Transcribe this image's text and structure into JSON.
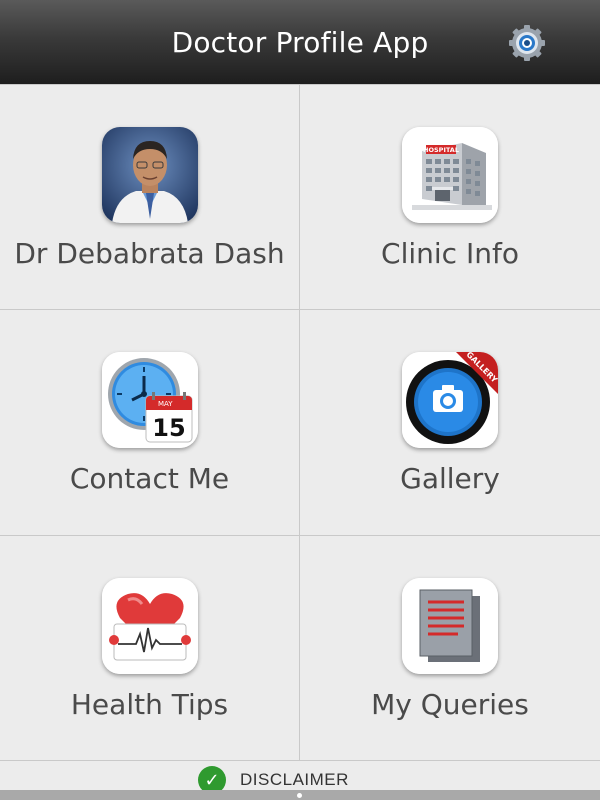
{
  "header": {
    "title": "Doctor Profile App",
    "settings_icon": "gear-icon"
  },
  "tiles": [
    {
      "label": "Dr Debabrata Dash",
      "icon": "doctor-photo-icon"
    },
    {
      "label": "Clinic Info",
      "icon": "hospital-icon",
      "icon_text": "HOSPITAL"
    },
    {
      "label": "Contact Me",
      "icon": "clock-calendar-icon",
      "month": "MAY",
      "day": "15"
    },
    {
      "label": "Gallery",
      "icon": "camera-gallery-icon",
      "ribbon": "GALLERY"
    },
    {
      "label": "Health Tips",
      "icon": "heart-ecg-icon"
    },
    {
      "label": "My Queries",
      "icon": "documents-icon"
    }
  ],
  "footer": {
    "disclaimer_label": "DISCLAIMER",
    "check_icon": "check-icon"
  },
  "colors": {
    "titlebar": "#2e2e2e",
    "background": "#ececec",
    "label_text": "#4a4a4a",
    "check_green": "#2f9a2f"
  }
}
